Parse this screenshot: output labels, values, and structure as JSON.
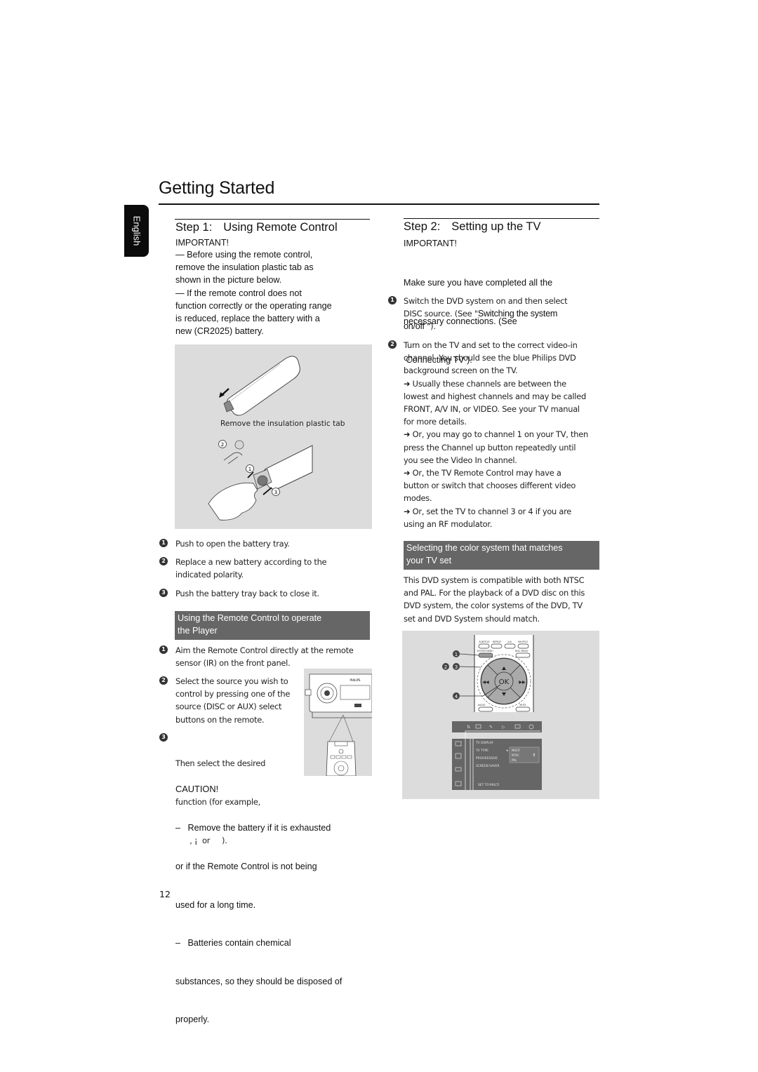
{
  "page": {
    "title": "Getting Started",
    "language_tab": "English",
    "page_number": "12"
  },
  "step1": {
    "label": "Step 1:",
    "title": "Using Remote Control",
    "important_label": "IMPORTANT!",
    "important_lines": [
      "— Before using the remote control,",
      "remove the insulation plastic tab as",
      "shown in the picture below.",
      "— If the remote control does not",
      "function correctly or the operating range",
      "is reduced, replace the battery with a",
      "new (CR2025) battery."
    ],
    "figure": {
      "caption": "Remove the insulation plastic tab",
      "callouts": [
        "1",
        "2",
        "3"
      ]
    },
    "battery_steps": [
      {
        "num": "1",
        "lines": [
          "Push to open the battery tray."
        ]
      },
      {
        "num": "2",
        "lines": [
          "Replace a new battery according to the",
          "indicated polarity."
        ]
      },
      {
        "num": "3",
        "lines": [
          "Push the battery tray back to close it."
        ]
      }
    ],
    "operate_banner": [
      "Using the Remote Control to operate",
      "the Player"
    ],
    "operate_steps": [
      {
        "num": "1",
        "lines": [
          "Aim the Remote Control directly at the remote",
          "sensor (IR) on the front panel."
        ]
      },
      {
        "num": "2",
        "lines": [
          "Select the source you wish to",
          "control by pressing one of the",
          "source (DISC or AUX) select",
          "buttons on the remote."
        ]
      },
      {
        "num": "3",
        "lines": [
          "Then select the desired",
          "function (for example,",
          "      , ¡  or     )."
        ]
      }
    ],
    "device_figure": {
      "brand_label": "PHILIPS"
    },
    "caution_label": "CAUTION!",
    "caution_lines": [
      "–   Remove the battery if it is exhausted",
      "or if the Remote Control is not being",
      "used for a long time.",
      "–   Batteries contain chemical",
      "substances, so they should be disposed of",
      "properly."
    ]
  },
  "step2": {
    "label": "Step 2:",
    "title": "Setting up the TV",
    "important_label": "IMPORTANT!",
    "important_lines": [
      "Make sure you have completed all the",
      "necessary connections. (See",
      " Connecting TV )."
    ],
    "step_a": {
      "num": "1",
      "line1": "Switch the DVD system on and then select",
      "line2_a": "DISC source. (See \"",
      "line2_b": "Switching the system",
      "line3_a": "on/off",
      "line3_b": " \")."
    },
    "step_b": {
      "num": "2",
      "lines": [
        "Turn on the TV and set to the correct video-in",
        "channel. You should see the blue Philips DVD",
        "background screen on the TV.",
        "➜ Usually these channels are between the",
        "lowest and highest channels and may be called",
        "FRONT, A/V IN, or VIDEO. See your TV manual",
        "for more details.",
        "➜ Or, you may go to channel 1 on your TV, then",
        "press the Channel up button repeatedly until",
        "you see the Video In channel.",
        "➜ Or, the TV Remote Control may have a",
        "button or switch that chooses different video",
        "modes.",
        "➜ Or, set the TV to channel 3 or 4 if you are",
        "using an RF modulator."
      ]
    },
    "color_banner": [
      "Selecting the color system that matches",
      "your TV set"
    ],
    "color_text": [
      "This DVD system is compatible with both NTSC",
      "and PAL. For the playback of a DVD disc on this",
      "DVD system, the color systems of the DVD, TV",
      "set and DVD System should match."
    ],
    "remote_figure": {
      "buttons_top": [
        "SUBTITLE",
        "REPEAT",
        "A-B",
        "SHUFFLE"
      ],
      "system_menu": "SYSTEM MENU",
      "disc_menu": "DISC MENU",
      "ok_label": "OK",
      "audio": "AUDIO",
      "mute": "MUTE",
      "callouts": [
        "1",
        "2",
        "3",
        "4"
      ]
    },
    "menu_figure": {
      "items": [
        "TV DISPLAY",
        "TV TYPE",
        "PROGRESSIVE",
        "SCREEN SAVER"
      ],
      "options": [
        "MULTI",
        "NTSC",
        "PAL"
      ],
      "footer": "SET TO MULTI"
    }
  }
}
